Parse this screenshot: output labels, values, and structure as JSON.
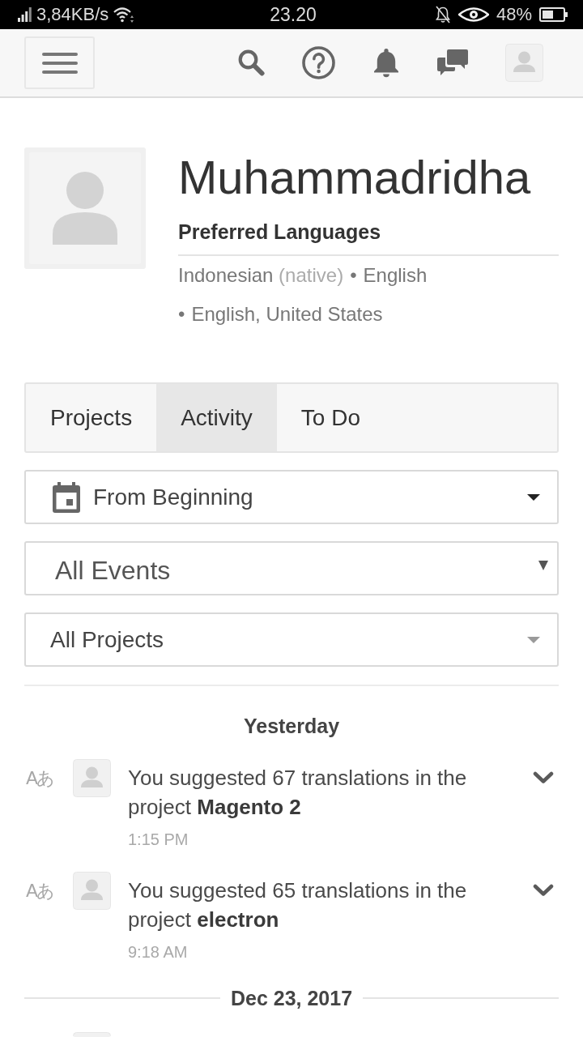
{
  "status_bar": {
    "network_speed": "3,84KB/s",
    "time": "23.20",
    "battery": "48%"
  },
  "profile": {
    "name": "Muhammadridha",
    "languages_heading": "Preferred Languages",
    "languages": [
      {
        "name": "Indonesian",
        "note": "(native)"
      },
      {
        "separator": "•",
        "name": "English"
      },
      {
        "separator": "•",
        "name": "English, United States"
      }
    ]
  },
  "tabs": [
    {
      "label": "Projects",
      "selected": false
    },
    {
      "label": "Activity",
      "selected": true
    },
    {
      "label": "To Do",
      "selected": false
    }
  ],
  "filters": [
    {
      "kind": "date",
      "value": "From Beginning"
    },
    {
      "kind": "select",
      "value": "All Events"
    },
    {
      "kind": "plain",
      "value": "All Projects"
    }
  ],
  "activity": [
    {
      "date": "Yesterday",
      "events": [
        {
          "icon_text": "Aあ",
          "avatar": true,
          "text": "You suggested 67 translations in the project **Magento 2**",
          "time": "1:15 PM"
        },
        {
          "icon_text": "Aあ",
          "avatar": true,
          "text": "You suggested 65 translations in the project **electron**",
          "time": "9:18 AM"
        }
      ]
    },
    {
      "date": "Dec 23, 2017",
      "events": [
        {
          "avatar": true
        }
      ]
    }
  ]
}
